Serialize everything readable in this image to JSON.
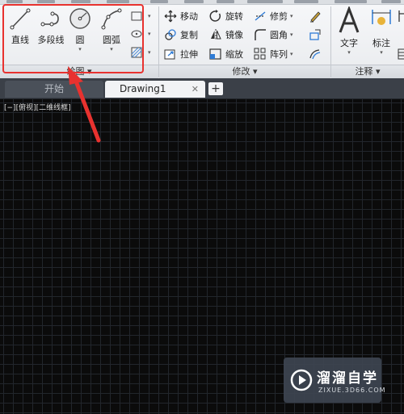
{
  "ribbon": {
    "draw_panel": {
      "title": "绘图",
      "line_label": "直线",
      "polyline_label": "多段线",
      "circle_label": "圆",
      "arc_label": "圆弧"
    },
    "modify_panel": {
      "title": "修改",
      "move_label": "移动",
      "rotate_label": "旋转",
      "trim_label": "修剪",
      "copy_label": "复制",
      "mirror_label": "镜像",
      "fillet_label": "圆角",
      "stretch_label": "拉伸",
      "scale_label": "缩放",
      "array_label": "阵列"
    },
    "annotation_panel": {
      "title": "注释",
      "text_label": "文字",
      "dimension_label": "标注"
    },
    "dropdown_glyph": "▾"
  },
  "tabs": {
    "start_label": "开始",
    "drawing_label": "Drawing1",
    "close_glyph": "✕",
    "add_glyph": "+"
  },
  "viewport": {
    "label": "[−][俯视][二维线框]"
  },
  "watermark": {
    "title": "溜溜自学",
    "url": "ZIXUE.3D66.COM"
  },
  "colors": {
    "highlight": "#e8322f",
    "canvas": "#0b0b0b",
    "accent_blue": "#2e7bd6"
  }
}
